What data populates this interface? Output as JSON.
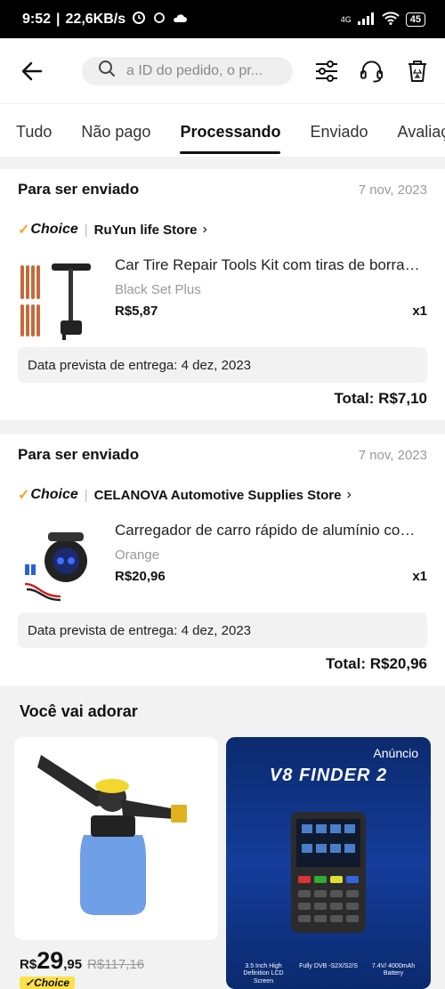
{
  "status_bar": {
    "time": "9:52",
    "network_speed": "22,6KB/s",
    "signal_label": "4G",
    "battery": "45"
  },
  "search": {
    "placeholder": "a ID do pedido, o pr..."
  },
  "tabs": [
    {
      "label": "Tudo",
      "active": false
    },
    {
      "label": "Não pago",
      "active": false
    },
    {
      "label": "Processando",
      "active": true
    },
    {
      "label": "Enviado",
      "active": false
    },
    {
      "label": "Avaliação",
      "active": false
    }
  ],
  "orders": [
    {
      "status": "Para ser enviado",
      "date": "7 nov, 2023",
      "choice_label": "Choice",
      "store": "RuYun life Store",
      "item_title": "Car Tire Repair Tools Kit com tiras de borracha",
      "variant": "Black Set Plus",
      "price": "R$5,87",
      "qty": "x1",
      "delivery": "Data prevista de entrega: 4 dez, 2023",
      "total": "Total: R$7,10"
    },
    {
      "status": "Para ser enviado",
      "date": "7 nov, 2023",
      "choice_label": "Choice",
      "store": "CELANOVA Automotive Supplies Store",
      "item_title": "Carregador de carro rápido de alumínio com display",
      "variant": "Orange",
      "price": "R$20,96",
      "qty": "x1",
      "delivery": "Data prevista de entrega: 4 dez, 2023",
      "total": "Total: R$20,96"
    }
  ],
  "recommendations": {
    "title": "Você vai adorar",
    "product": {
      "currency": "R$",
      "price_int": "29",
      "price_dec": ",95",
      "old_price": "R$117,16",
      "badge": "Choice"
    },
    "ad": {
      "label": "Anúncio",
      "title": "V8 FINDER 2",
      "features": [
        "3.5 Inch High Definition LCD Screen",
        "Fully DVB -S2X/S2/S",
        "7.4V/ 4000mAh Battery"
      ]
    }
  }
}
